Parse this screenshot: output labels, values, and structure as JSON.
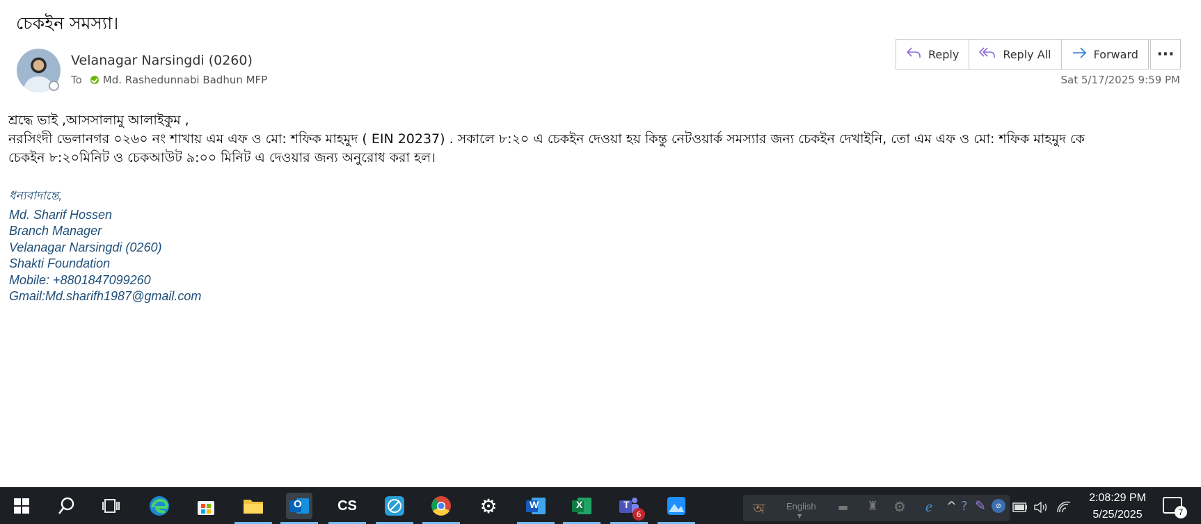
{
  "email": {
    "subject": "চেকইন সমস্যা।",
    "sender": "Velanagar Narsingdi (0260)",
    "to_label": "To",
    "recipient": "Md. Rashedunnabi Badhun MFP",
    "date": "Sat 5/17/2025 9:59 PM",
    "actions": {
      "reply": "Reply",
      "reply_all": "Reply All",
      "forward": "Forward",
      "more": "···"
    },
    "body": {
      "line1": "শ্রদ্ধে ভাই ,আসসালামু আলাইকুম ,",
      "line2": "নরসিংদী ভেলানগর ০২৬০ নং শাখায় এম এফ ও মো: শফিক  মাহমুদ ( EIN 20237) . সকালে ৮:২০ এ চেকইন দেওয়া হয়  কিন্তু নেটওয়ার্ক সমস্যার জন্য চেকইন দেখাইনি, তো  এম এফ ও মো: শফিক মাহমুদ  কে",
      "line3": "চেকইন ৮:২০মিনিট ও চেকআউট  ৯:০০ মিনিট এ দেওয়ার জন্য অনুরোধ করা হল।"
    },
    "signature": {
      "greeting": "ধন্যবাদান্তে,",
      "name": "Md. Sharif Hossen",
      "title": "Branch Manager",
      "branch": "Velanagar Narsingdi (0260)",
      "org": "Shakti Foundation",
      "mobile": "Mobile: +8801847099260",
      "gmail": "Gmail:Md.sharifh1987@gmail.com"
    }
  },
  "taskbar": {
    "teams_badge": "6",
    "cs_label": "CS",
    "word_label": "W",
    "excel_label": "X",
    "outlook_label": "O",
    "teams_label": "T",
    "language": "English",
    "time": "2:08:29 PM",
    "date": "5/25/2025",
    "notification_count": "7"
  }
}
